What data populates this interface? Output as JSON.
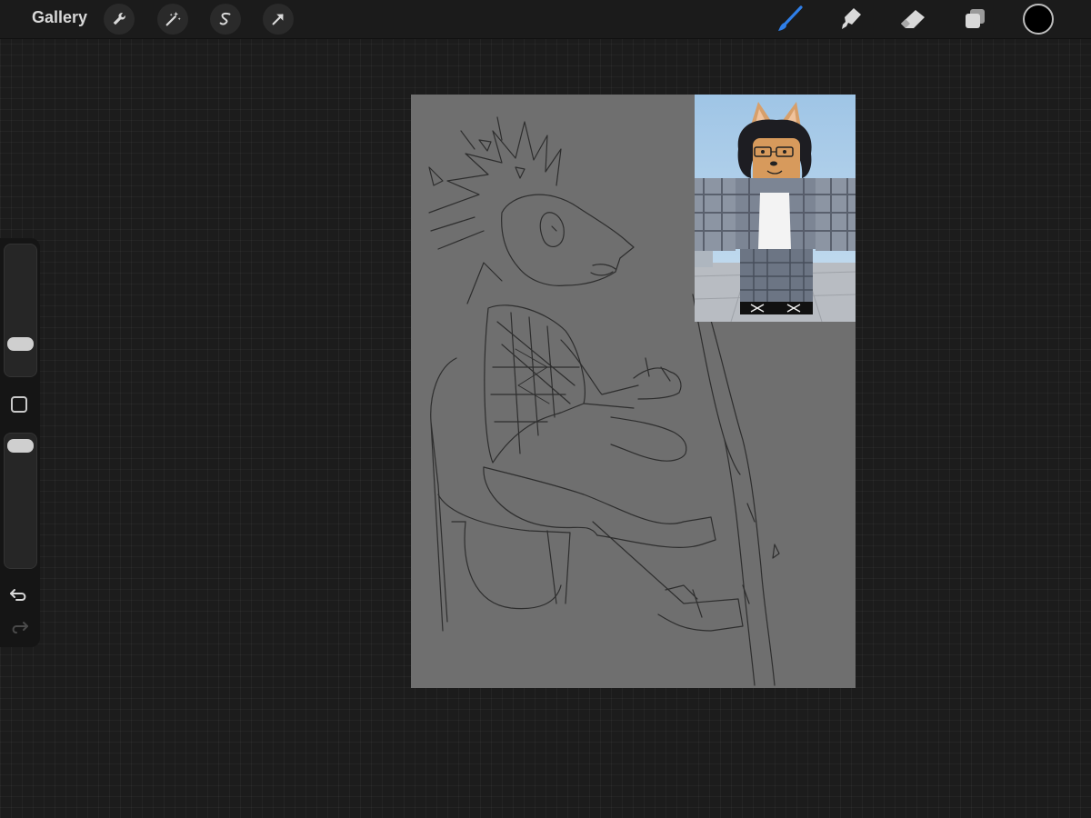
{
  "toolbar": {
    "gallery_label": "Gallery",
    "left_tools": [
      {
        "icon": "wrench-icon",
        "name": "actions"
      },
      {
        "icon": "magic-wand-icon",
        "name": "adjustments"
      },
      {
        "icon": "selection-s-icon",
        "name": "selection"
      },
      {
        "icon": "arrow-cursor-icon",
        "name": "transform"
      }
    ],
    "right_tools": [
      {
        "icon": "brush-icon",
        "name": "brush",
        "active": true
      },
      {
        "icon": "smudge-icon",
        "name": "smudge"
      },
      {
        "icon": "eraser-icon",
        "name": "eraser"
      },
      {
        "icon": "layers-icon",
        "name": "layers"
      }
    ],
    "current_color": "#000000",
    "active_color": "#2f7fe8",
    "icon_color": "#d9d9d9"
  },
  "sidebar": {
    "brush_size_level": 0.2,
    "opacity_level": 0.02,
    "undo_icon": "undo-icon",
    "redo_icon": "redo-icon"
  },
  "canvas": {
    "background_color": "#6f6f6f",
    "sketch_stroke": "#2e2e2e"
  },
  "reference_image": {
    "subject": "character-avatar-reference"
  }
}
